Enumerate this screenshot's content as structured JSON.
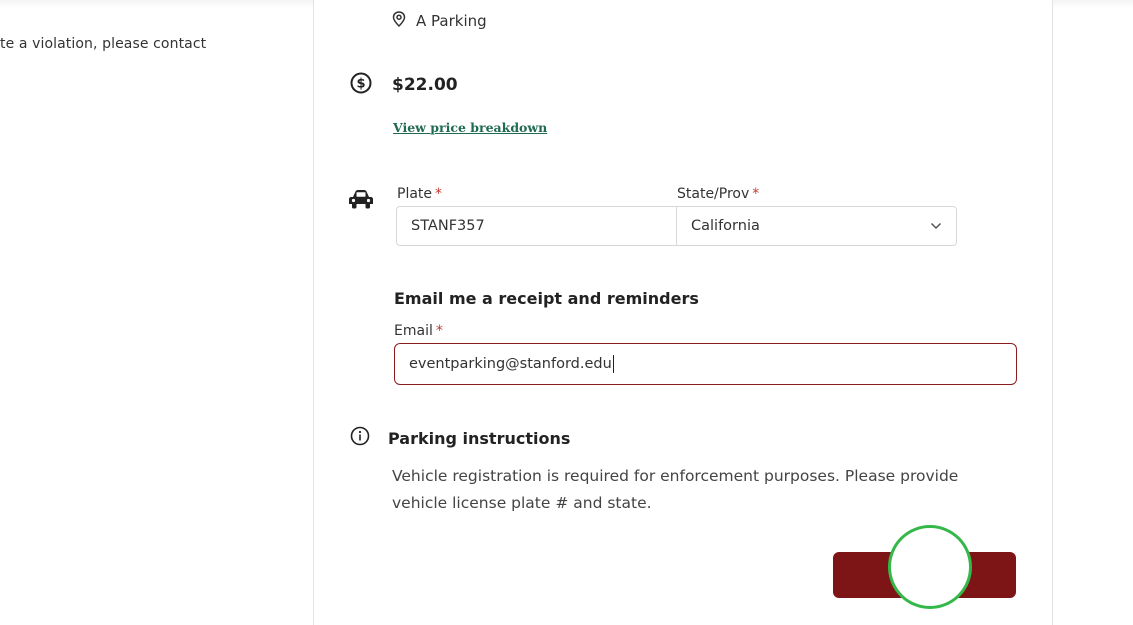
{
  "left_text": "te a violation, please contact",
  "location": {
    "icon": "map-pin-icon",
    "label": "A Parking"
  },
  "price": {
    "icon": "dollar-circle-icon",
    "amount": "$22.00",
    "breakdown_link": "View price breakdown"
  },
  "vehicle": {
    "icon": "car-icon",
    "plate_label": "Plate",
    "plate_value": "STANF357",
    "state_label": "State/Prov",
    "state_value": "California",
    "required_mark": "*"
  },
  "email": {
    "heading": "Email me a receipt and reminders",
    "label": "Email",
    "value": "eventparking@stanford.edu",
    "required_mark": "*"
  },
  "instructions": {
    "icon": "info-icon",
    "title": "Parking instructions",
    "text": "Vehicle registration is required for enforcement purposes. Please provide vehicle license plate # and state."
  },
  "colors": {
    "accent": "#7d1416",
    "link": "#1f6b4f",
    "click_indicator": "#35b84a",
    "error_border": "#8c1c1c"
  }
}
